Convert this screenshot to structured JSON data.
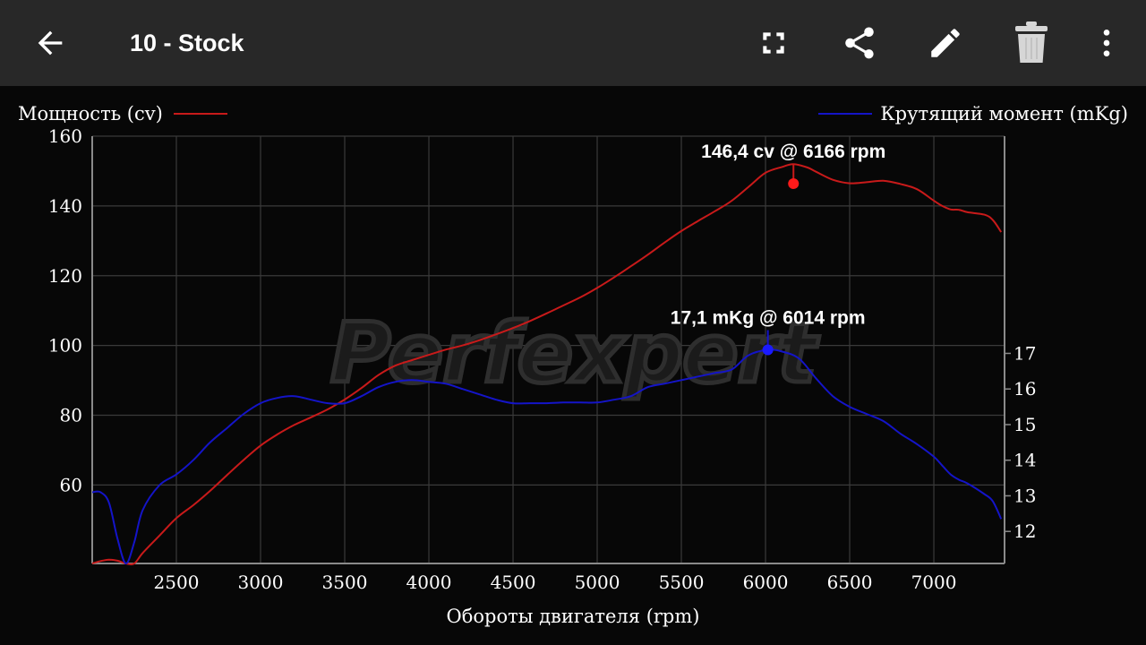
{
  "appbar": {
    "title": "10 - Stock",
    "icons": [
      "back-arrow-icon",
      "fullscreen-icon",
      "share-icon",
      "edit-pencil-icon",
      "delete-trash-icon",
      "more-vert-icon"
    ],
    "background": "#282828"
  },
  "watermark": "Perfexpert",
  "chart_data": {
    "type": "line",
    "xlabel": "Обороты двигателя (rpm)",
    "xlim": [
      2000,
      7420
    ],
    "xticks": [
      2500,
      3000,
      3500,
      4000,
      4500,
      5000,
      5500,
      6000,
      6500,
      7000
    ],
    "grid": true,
    "legend": [
      "top-left",
      "top-right"
    ],
    "series": [
      {
        "name": "Мощность (cv)",
        "axis": "left",
        "color": "#c81a1a",
        "ylim": [
          37.5,
          160
        ],
        "yticks": [
          60,
          80,
          100,
          120,
          140,
          160
        ],
        "x": [
          2000,
          2050,
          2100,
          2150,
          2200,
          2250,
          2300,
          2400,
          2500,
          2600,
          2700,
          2800,
          2900,
          3000,
          3100,
          3200,
          3300,
          3400,
          3500,
          3600,
          3700,
          3800,
          3900,
          4000,
          4100,
          4200,
          4300,
          4400,
          4500,
          4600,
          4700,
          4800,
          4900,
          5000,
          5100,
          5200,
          5300,
          5400,
          5500,
          5600,
          5700,
          5800,
          5900,
          6000,
          6100,
          6166,
          6250,
          6300,
          6400,
          6500,
          6600,
          6700,
          6800,
          6900,
          7000,
          7050,
          7100,
          7150,
          7200,
          7300,
          7350,
          7400
        ],
        "values": [
          37.5,
          38.2,
          38.6,
          38.3,
          36.5,
          37.5,
          40.5,
          45.5,
          50.5,
          54.2,
          58.3,
          62.8,
          67.2,
          71.3,
          74.5,
          77.2,
          79.4,
          81.7,
          84.5,
          87.8,
          91.5,
          94.2,
          95.8,
          97.3,
          98.8,
          100.0,
          101.5,
          103.2,
          105.0,
          107.0,
          109.2,
          111.5,
          113.8,
          116.5,
          119.5,
          122.7,
          126.0,
          129.5,
          132.8,
          135.7,
          138.5,
          141.5,
          145.5,
          149.5,
          151.2,
          152.0,
          151.0,
          149.8,
          147.5,
          146.5,
          146.8,
          147.2,
          146.3,
          144.8,
          141.5,
          140.0,
          139.0,
          138.9,
          138.2,
          137.5,
          136.0,
          132.5
        ]
      },
      {
        "name": "Крутящий момент (mKg)",
        "axis": "right",
        "color": "#1414c8",
        "ylim": [
          11.1,
          23.1
        ],
        "yticks": [
          12,
          13,
          14,
          15,
          16,
          17
        ],
        "x": [
          2000,
          2050,
          2100,
          2150,
          2200,
          2250,
          2300,
          2400,
          2500,
          2600,
          2700,
          2800,
          2900,
          3000,
          3100,
          3200,
          3300,
          3400,
          3500,
          3600,
          3700,
          3800,
          3900,
          4000,
          4100,
          4200,
          4300,
          4400,
          4500,
          4600,
          4700,
          4800,
          4900,
          5000,
          5100,
          5200,
          5300,
          5400,
          5500,
          5600,
          5700,
          5800,
          5900,
          6014,
          6100,
          6200,
          6300,
          6400,
          6500,
          6600,
          6700,
          6800,
          6900,
          7000,
          7050,
          7100,
          7150,
          7200,
          7300,
          7350,
          7400
        ],
        "values": [
          13.1,
          13.1,
          12.8,
          11.8,
          11.1,
          11.7,
          12.6,
          13.3,
          13.6,
          14.0,
          14.5,
          14.9,
          15.3,
          15.6,
          15.75,
          15.8,
          15.7,
          15.6,
          15.6,
          15.8,
          16.05,
          16.2,
          16.25,
          16.2,
          16.15,
          16.0,
          15.85,
          15.7,
          15.6,
          15.6,
          15.6,
          15.62,
          15.62,
          15.62,
          15.7,
          15.8,
          16.05,
          16.15,
          16.25,
          16.35,
          16.45,
          16.55,
          16.95,
          17.1,
          17.05,
          16.85,
          16.3,
          15.8,
          15.5,
          15.3,
          15.1,
          14.75,
          14.45,
          14.1,
          13.85,
          13.6,
          13.45,
          13.35,
          13.05,
          12.85,
          12.35
        ]
      }
    ],
    "annotations": [
      {
        "series": 0,
        "x": 6166,
        "y": 146.4,
        "text": "146,4 cv @ 6166 rpm"
      },
      {
        "series": 1,
        "x": 6014,
        "y": 17.1,
        "text": "17,1 mKg @ 6014 rpm"
      }
    ]
  }
}
